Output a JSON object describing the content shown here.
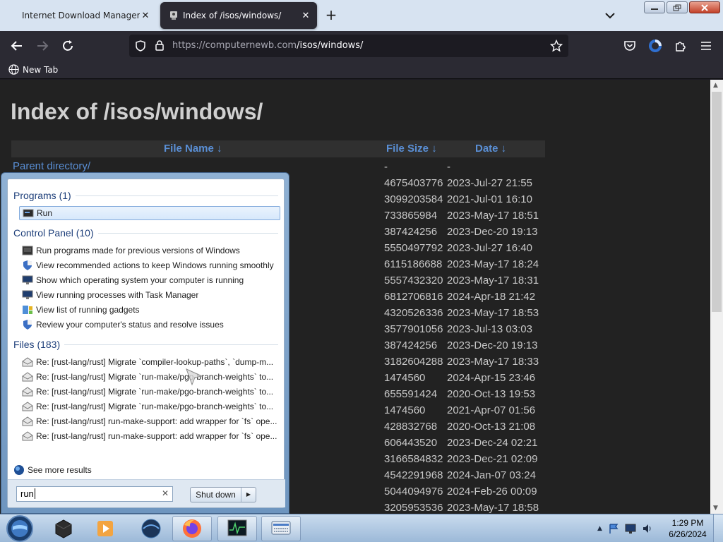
{
  "browser": {
    "tabs": [
      {
        "title": "Internet Download Manager is a",
        "active": false
      },
      {
        "title": "Index of /isos/windows/",
        "active": true
      }
    ],
    "url_host": "https://computernewb.com",
    "url_path": "/isos/windows/",
    "bookmark": "New Tab"
  },
  "page": {
    "title": "Index of /isos/windows/",
    "headers": {
      "name": "File Name  ↓",
      "size": "File Size  ↓",
      "date": "Date  ↓"
    },
    "parent": {
      "name": "Parent directory/",
      "size": "-",
      "date": "-"
    },
    "rows": [
      {
        "size": "4675403776",
        "date": "2023-Jul-27 21:55"
      },
      {
        "size": "3099203584",
        "date": "2021-Jul-01 16:10"
      },
      {
        "size": "733865984",
        "date": "2023-May-17 18:51"
      },
      {
        "size": "387424256",
        "date": "2023-Dec-20 19:13"
      },
      {
        "size": "5550497792",
        "date": "2023-Jul-27 16:40"
      },
      {
        "size": "6115186688",
        "date": "2023-May-17 18:24"
      },
      {
        "size": "5557432320",
        "date": "2023-May-17 18:31"
      },
      {
        "size": "6812706816",
        "date": "2024-Apr-18 21:42"
      },
      {
        "size": "4320526336",
        "date": "2023-May-17 18:53"
      },
      {
        "size": "3577901056",
        "date": "2023-Jul-13 03:03"
      },
      {
        "size": "387424256",
        "date": "2023-Dec-20 19:13"
      },
      {
        "size": "3182604288",
        "date": "2023-May-17 18:33"
      },
      {
        "size": "1474560",
        "date": "2024-Apr-15 23:46"
      },
      {
        "size": "655591424",
        "date": "2020-Oct-13 19:53"
      },
      {
        "size": "1474560",
        "date": "2021-Apr-07 01:56"
      },
      {
        "size": "428832768",
        "date": "2020-Oct-13 21:08"
      },
      {
        "size": "606443520",
        "date": "2023-Dec-24 02:21"
      },
      {
        "size": "3166584832",
        "date": "2023-Dec-21 02:09"
      },
      {
        "size": "4542291968",
        "date": "2024-Jan-07 03:24"
      },
      {
        "size": "5044094976",
        "date": "2024-Feb-26 00:09"
      },
      {
        "size": "3205953536",
        "date": "2023-May-17 18:58"
      }
    ]
  },
  "startmenu": {
    "programs_header": "Programs (1)",
    "programs": [
      {
        "label": "Run",
        "icon": "run-icon",
        "selected": true
      }
    ],
    "control_panel_header": "Control Panel (10)",
    "control_panel": [
      {
        "label": "Run programs made for previous versions of Windows",
        "icon": "compat-icon"
      },
      {
        "label": "View recommended actions to keep Windows running smoothly",
        "icon": "shield-icon"
      },
      {
        "label": "Show which operating system your computer is running",
        "icon": "monitor-icon"
      },
      {
        "label": "View running processes with Task Manager",
        "icon": "monitor-icon"
      },
      {
        "label": "View list of running gadgets",
        "icon": "gadgets-icon"
      },
      {
        "label": "Review your computer's status and resolve issues",
        "icon": "shield-icon"
      }
    ],
    "files_header": "Files (183)",
    "files": [
      {
        "label": "Re: [rust-lang/rust] Migrate `compiler-lookup-paths`, `dump-m..."
      },
      {
        "label": "Re: [rust-lang/rust] Migrate `run-make/pgo-branch-weights` to..."
      },
      {
        "label": "Re: [rust-lang/rust] Migrate `run-make/pgo-branch-weights` to..."
      },
      {
        "label": "Re: [rust-lang/rust] Migrate `run-make/pgo-branch-weights` to..."
      },
      {
        "label": "Re: [rust-lang/rust] run-make-support: add wrapper for `fs` ope..."
      },
      {
        "label": "Re: [rust-lang/rust] run-make-support: add wrapper for `fs` ope..."
      }
    ],
    "see_more": "See more results",
    "search_value": "run",
    "shutdown_label": "Shut down"
  },
  "taskbar": {
    "time": "1:29 PM",
    "date": "6/26/2024"
  }
}
